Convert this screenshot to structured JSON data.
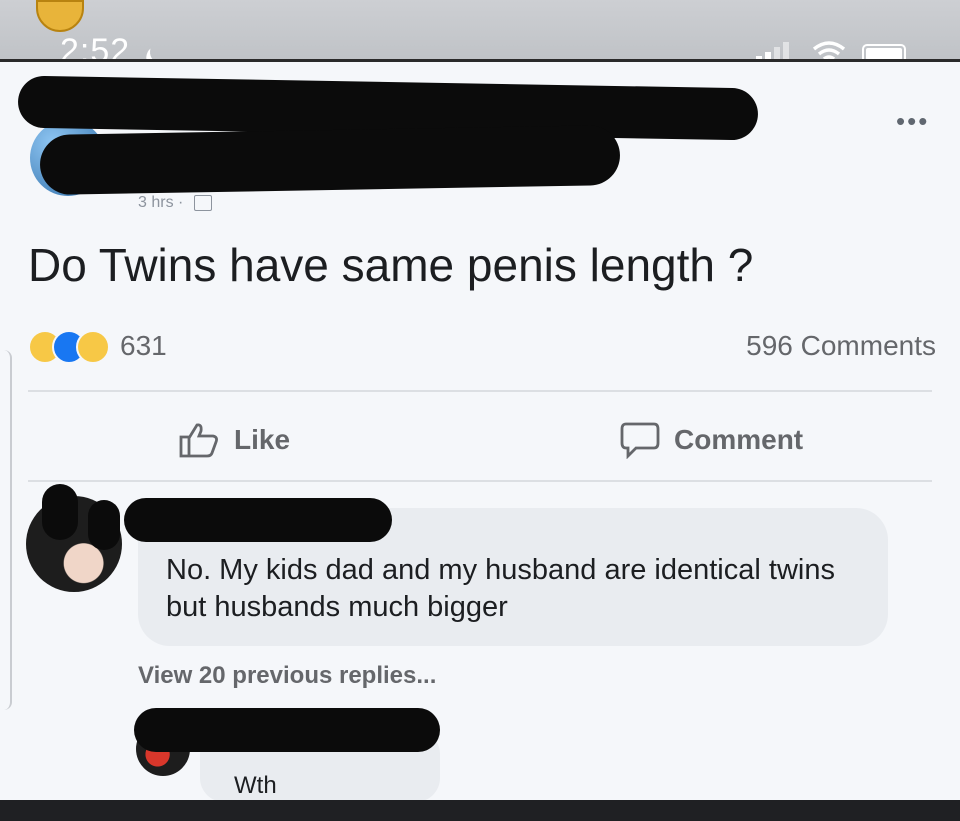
{
  "status_bar": {
    "time": "2:52"
  },
  "post": {
    "meta": "3 hrs ·",
    "text": "Do Twins have same penis length ?",
    "reaction_count": "631",
    "comments_count": "596 Comments",
    "more_label": "•••"
  },
  "actions": {
    "like_label": "Like",
    "comment_label": "Comment"
  },
  "comment": {
    "text": "No. My kids dad and my husband are identical twins but husbands much bigger",
    "view_replies": "View 20 previous replies..."
  },
  "reply": {
    "text": "Wth"
  },
  "colors": {
    "like_blue": "#1877f2",
    "reaction_yellow": "#f7c846",
    "muted_text": "#65676b"
  },
  "icons": [
    "moon-icon",
    "signal-icon",
    "wifi-icon",
    "battery-icon",
    "more-icon",
    "globe-icon",
    "thumbs-up-icon",
    "comment-icon"
  ]
}
